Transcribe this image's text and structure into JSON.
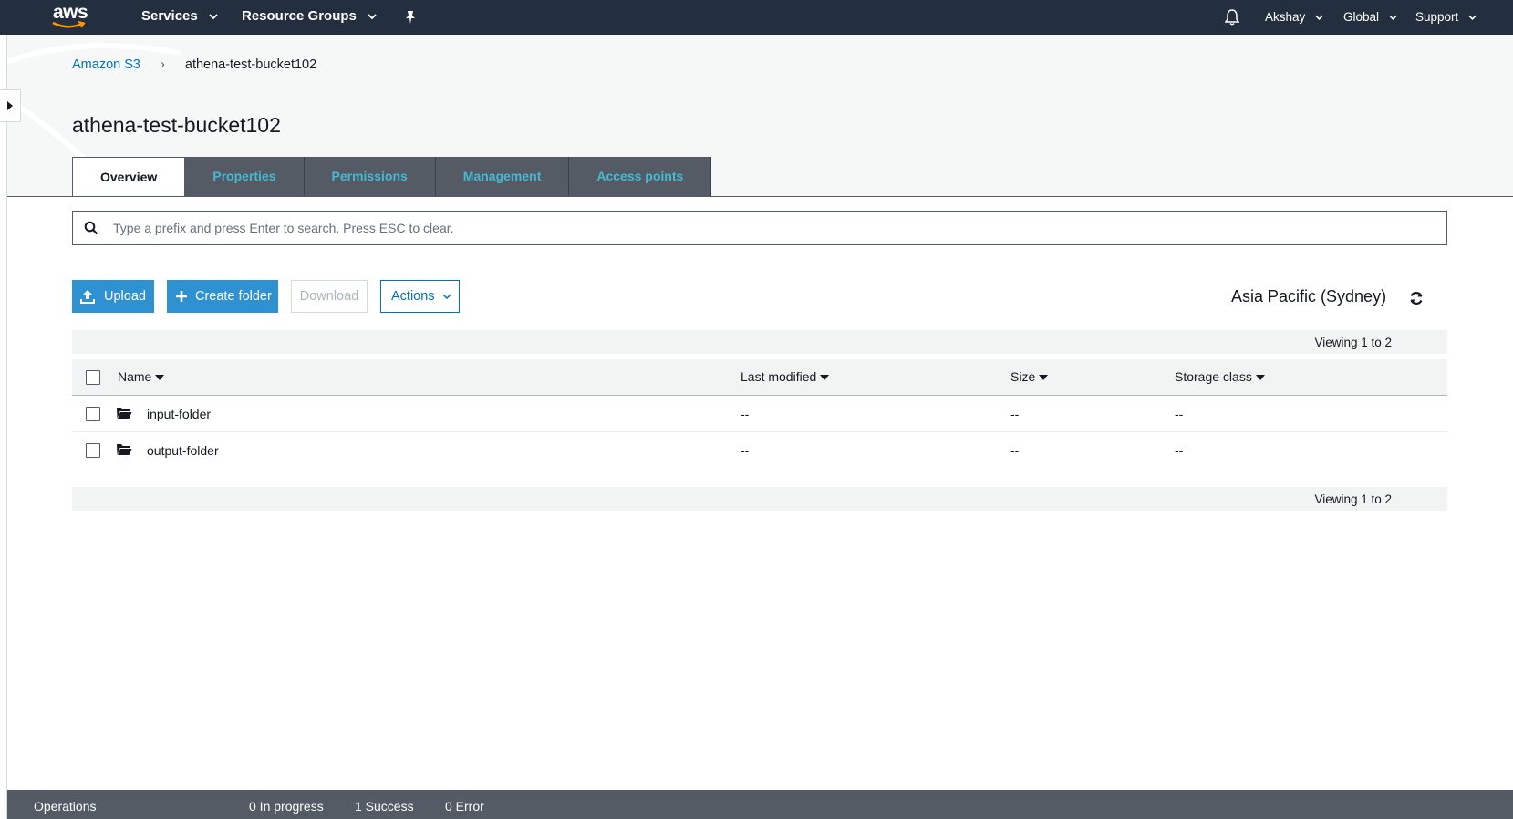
{
  "topnav": {
    "logo_text": "aws",
    "services": "Services",
    "resource_groups": "Resource Groups",
    "user": "Akshay",
    "region": "Global",
    "support": "Support"
  },
  "breadcrumb": {
    "root": "Amazon S3",
    "separator": "›",
    "current": "athena-test-bucket102"
  },
  "page": {
    "title": "athena-test-bucket102"
  },
  "tabs": [
    {
      "label": "Overview",
      "active": true
    },
    {
      "label": "Properties"
    },
    {
      "label": "Permissions"
    },
    {
      "label": "Management"
    },
    {
      "label": "Access points"
    }
  ],
  "search": {
    "placeholder": "Type a prefix and press Enter to search. Press ESC to clear.",
    "value": ""
  },
  "toolbar": {
    "upload": "Upload",
    "create_folder": "Create folder",
    "download": "Download",
    "actions": "Actions",
    "region_label": "Asia Pacific (Sydney)"
  },
  "table": {
    "viewing_top": "Viewing 1 to 2",
    "viewing_bottom": "Viewing 1 to 2",
    "columns": [
      "Name",
      "Last modified",
      "Size",
      "Storage class"
    ],
    "rows": [
      {
        "name": "input-folder",
        "last_modified": "--",
        "size": "--",
        "storage_class": "--"
      },
      {
        "name": "output-folder",
        "last_modified": "--",
        "size": "--",
        "storage_class": "--"
      }
    ]
  },
  "operations": {
    "label": "Operations",
    "in_progress": "0 In progress",
    "success": "1 Success",
    "error": "0 Error"
  },
  "colors": {
    "nav_bg": "#232f3e",
    "tab_bg": "#545b64",
    "tab_text": "#44b9d6",
    "primary": "#2e91d1",
    "link": "#0073bb"
  },
  "icons": [
    "bell-icon",
    "pin-icon",
    "search-icon",
    "upload-icon",
    "plus-icon",
    "refresh-icon",
    "folder-icon",
    "chevron-down-icon",
    "caret-right-icon"
  ]
}
